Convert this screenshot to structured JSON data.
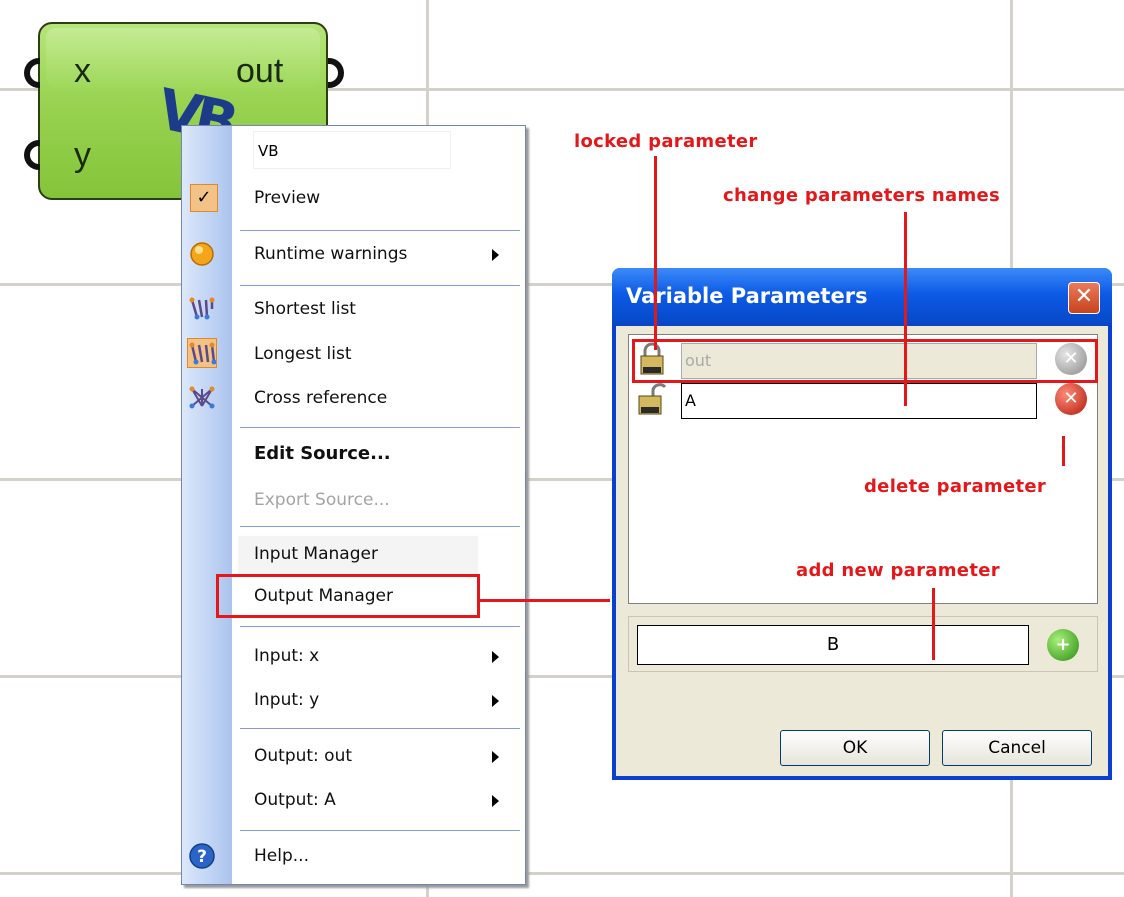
{
  "component": {
    "inputs": [
      "x",
      "y"
    ],
    "output": "out",
    "logo": "VB"
  },
  "context_menu": {
    "name_field": "VB",
    "items": [
      {
        "label": "Preview",
        "icon": "checkmark-icon",
        "checked": true
      },
      {
        "label": "Runtime warnings",
        "icon": "warning-dot-icon",
        "submenu": true
      },
      {
        "label": "Shortest list",
        "icon": "shortest-list-icon"
      },
      {
        "label": "Longest list",
        "icon": "longest-list-icon",
        "checked": true
      },
      {
        "label": "Cross reference",
        "icon": "cross-reference-icon"
      },
      {
        "label": "Edit Source...",
        "bold": true
      },
      {
        "label": "Export Source...",
        "disabled": true
      },
      {
        "label": "Input Manager"
      },
      {
        "label": "Output Manager",
        "highlighted": true
      },
      {
        "label": "Input: x",
        "submenu": true
      },
      {
        "label": "Input: y",
        "submenu": true
      },
      {
        "label": "Output: out",
        "submenu": true
      },
      {
        "label": "Output: A",
        "submenu": true
      },
      {
        "label": "Help...",
        "icon": "help-icon"
      }
    ]
  },
  "dialog": {
    "title": "Variable Parameters",
    "close_glyph": "✕",
    "params": [
      {
        "name": "out",
        "locked": true
      },
      {
        "name": "A",
        "locked": false
      }
    ],
    "new_param_value": "B",
    "ok_label": "OK",
    "cancel_label": "Cancel"
  },
  "annotations": {
    "locked_parameter": "locked parameter",
    "change_names": "change parameters names",
    "delete_parameter": "delete parameter",
    "add_new_parameter": "add new parameter"
  },
  "colors": {
    "annotation": "#e3181b",
    "component_green": "#99d351",
    "dialog_blue": "#0c5ae6"
  }
}
